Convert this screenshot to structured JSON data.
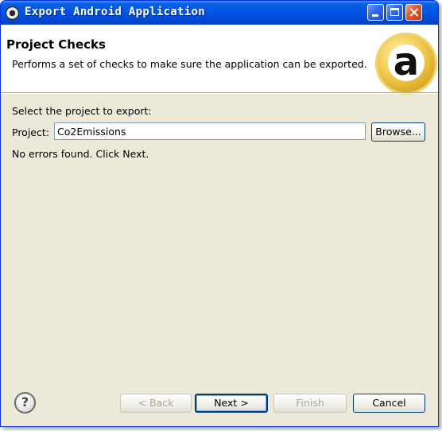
{
  "window": {
    "title": "Export Android Application"
  },
  "banner": {
    "title": "Project Checks",
    "description": "Performs a set of checks to make sure the application can be exported.",
    "logo_icon": "android-adt-badge-icon",
    "logo_glyph": "a"
  },
  "form": {
    "select_label": "Select the project to export:",
    "project_label": "Project:",
    "project_value": "Co2Emissions",
    "browse_label": "Browse...",
    "status": "No errors found. Click Next."
  },
  "footer": {
    "help_glyph": "?",
    "back_label": "< Back",
    "next_label": "Next >",
    "finish_label": "Finish",
    "cancel_label": "Cancel"
  },
  "colors": {
    "titlebar": "#0055e5",
    "dialog_bg": "#ece9d8",
    "badge_gold": "#d6a21d"
  }
}
